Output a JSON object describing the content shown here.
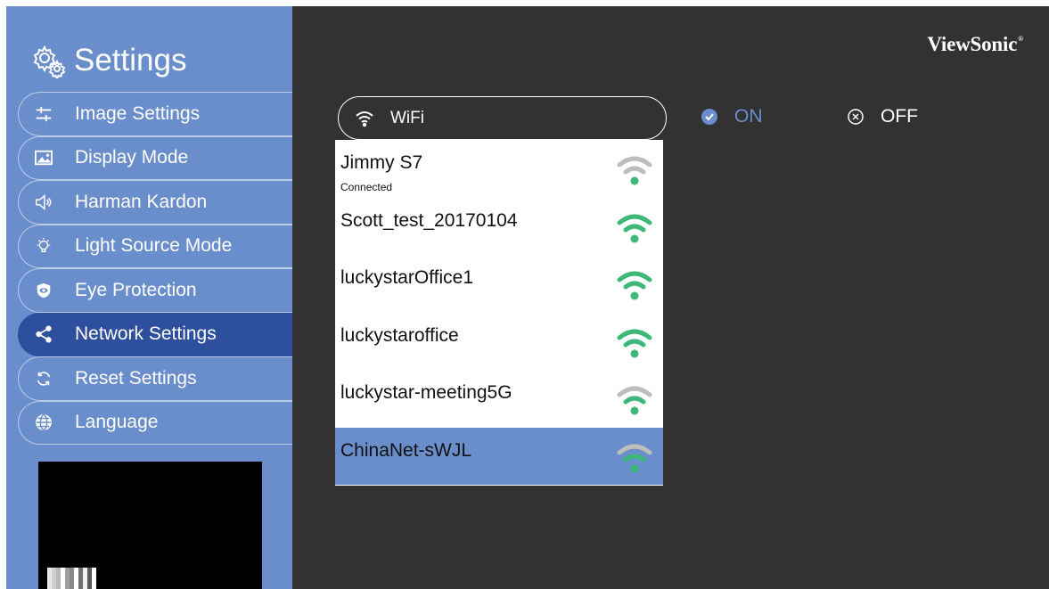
{
  "brand": "ViewSonic",
  "brand_mark": "®",
  "sidebar": {
    "title": "Settings",
    "items": [
      {
        "label": "Image Settings",
        "icon": "sliders-icon",
        "active": false
      },
      {
        "label": "Display Mode",
        "icon": "image-icon",
        "active": false
      },
      {
        "label": "Harman Kardon",
        "icon": "speaker-icon",
        "active": false
      },
      {
        "label": "Light Source Mode",
        "icon": "lightbulb-icon",
        "active": false
      },
      {
        "label": "Eye Protection",
        "icon": "eye-icon",
        "active": false
      },
      {
        "label": "Network Settings",
        "icon": "share-icon",
        "active": true
      },
      {
        "label": "Reset Settings",
        "icon": "refresh-icon",
        "active": false
      },
      {
        "label": "Language",
        "icon": "globe-icon",
        "active": false
      }
    ]
  },
  "wifi": {
    "label": "WiFi",
    "on_label": "ON",
    "off_label": "OFF",
    "selected": "on"
  },
  "networks": [
    {
      "name": "Jimmy S7",
      "status": "Connected",
      "signal_color": "#bdbdbd"
    },
    {
      "name": "Scott_test_20170104",
      "status": "",
      "signal_color": "#3cb878"
    },
    {
      "name": "luckystarOffice1",
      "status": "",
      "signal_color": "#3cb878"
    },
    {
      "name": "luckystaroffice",
      "status": "",
      "signal_color": "#3cb878"
    },
    {
      "name": "luckystar-meeting5G",
      "status": "",
      "signal_color": "#bdbdbd"
    },
    {
      "name": "ChinaNet-sWJL",
      "status": "",
      "signal_color": "#bdbdbd",
      "selected": true
    }
  ],
  "colors": {
    "sidebar_bg": "#6a8ecb",
    "sidebar_active": "#2d4f9e",
    "main_bg": "#323232",
    "signal_strong": "#3cb878",
    "signal_dot": "#3cb878",
    "signal_weak": "#bdbdbd"
  }
}
